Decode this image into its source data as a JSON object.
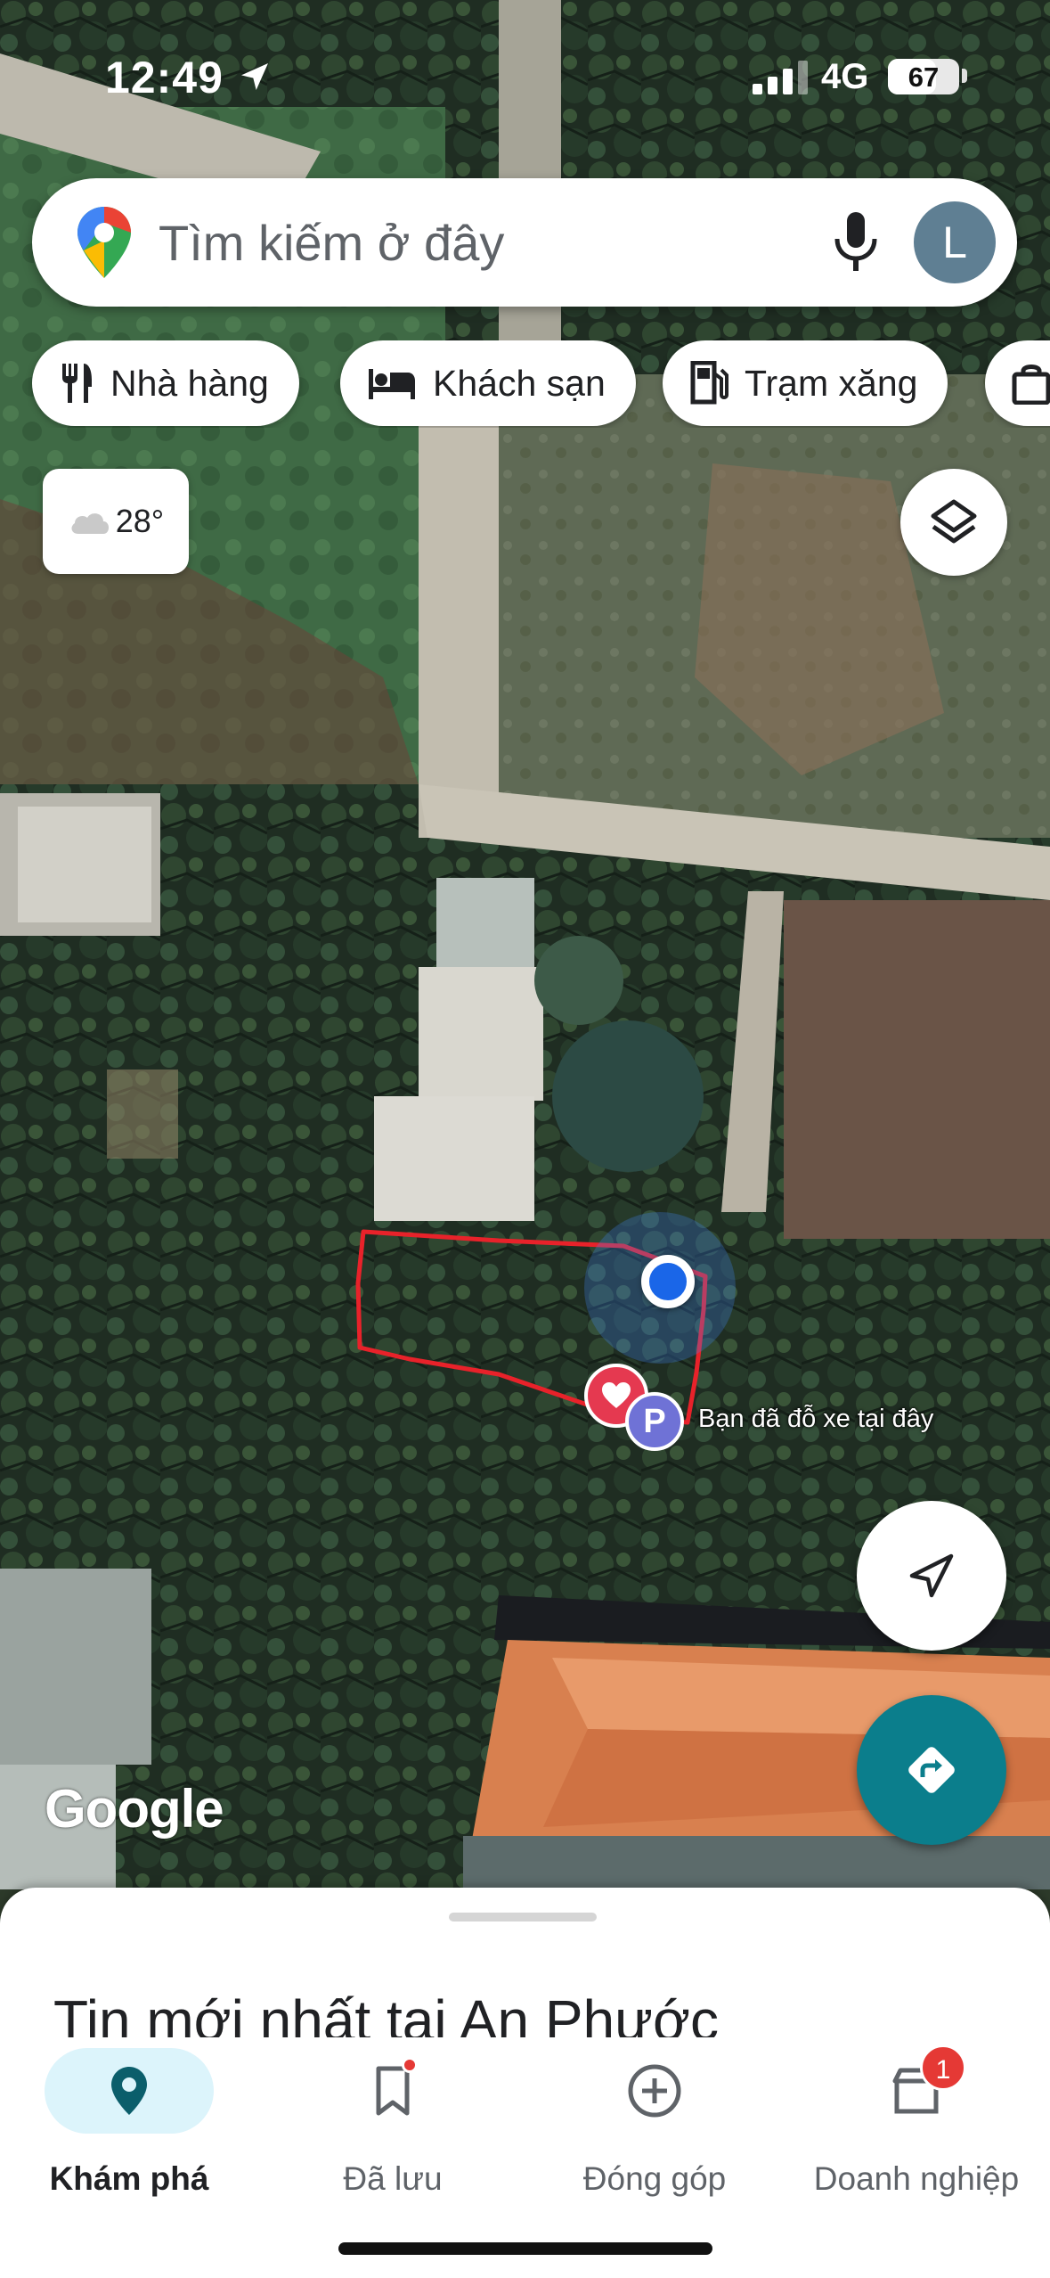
{
  "status_bar": {
    "time": "12:49",
    "network": "4G",
    "battery": "67",
    "battery_level": 0.67
  },
  "search": {
    "placeholder": "Tìm kiếm ở đây",
    "avatar_letter": "L",
    "icons": [
      "maps-pin-icon",
      "microphone-icon"
    ]
  },
  "chips": [
    {
      "label": "Nhà hàng",
      "icon": "restaurant-icon"
    },
    {
      "label": "Khách sạn",
      "icon": "bed-icon"
    },
    {
      "label": "Trạm xăng",
      "icon": "gas-station-icon"
    },
    {
      "label": "",
      "icon": "shopping-bag-icon"
    }
  ],
  "weather": {
    "temp": "28°",
    "icon": "cloud-icon"
  },
  "map": {
    "parking_label": "Bạn đã đỗ xe tại đây",
    "parking_letter": "P",
    "attribution": "Google"
  },
  "sheet": {
    "title": "Tin mới nhất tại An Phước"
  },
  "nav": [
    {
      "label": "Khám phá",
      "icon": "explore-pin-icon",
      "active": true
    },
    {
      "label": "Đã lưu",
      "icon": "bookmark-icon",
      "notify_dot": true
    },
    {
      "label": "Đóng góp",
      "icon": "add-circle-icon"
    },
    {
      "label": "Doanh nghiệp",
      "icon": "business-store-icon",
      "badge": "1"
    }
  ],
  "colors": {
    "accent": "#0b7e8c",
    "active_pill": "#dcf4fb",
    "location_blue": "#1a66e8",
    "annotation_red": "#e8222a"
  }
}
